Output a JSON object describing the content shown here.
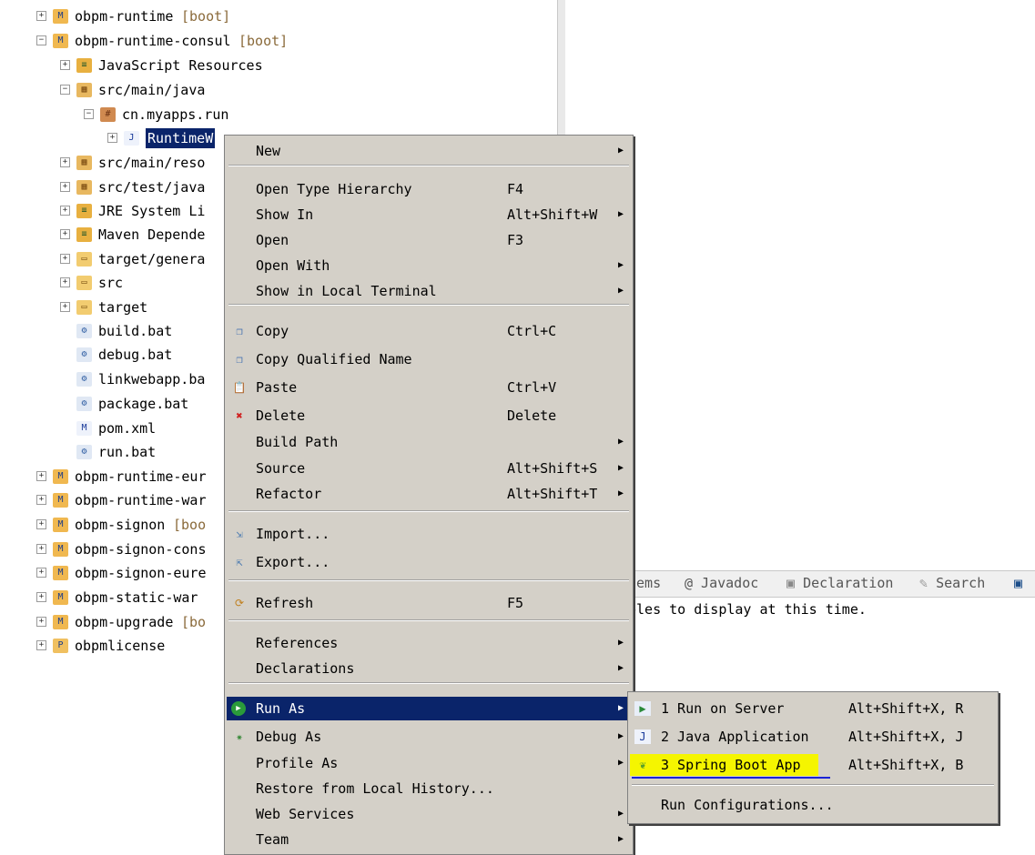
{
  "tree": {
    "items": [
      {
        "label": "obpm-runtime",
        "suffix": "[boot]",
        "expander": "+",
        "icon": "maven-project-icon"
      },
      {
        "label": "obpm-runtime-consul",
        "suffix": "[boot]",
        "expander": "−",
        "icon": "maven-project-icon"
      },
      {
        "label": "JavaScript Resources",
        "expander": "+",
        "icon": "library-icon"
      },
      {
        "label": "src/main/java",
        "expander": "−",
        "icon": "source-folder-icon"
      },
      {
        "label": "cn.myapps.run",
        "expander": "−",
        "icon": "package-icon"
      },
      {
        "label": "RuntimeW",
        "expander": "+",
        "icon": "java-file-icon",
        "selected": true
      },
      {
        "label": "src/main/reso",
        "expander": "+",
        "icon": "source-folder-icon"
      },
      {
        "label": "src/test/java",
        "expander": "+",
        "icon": "source-folder-icon"
      },
      {
        "label": "JRE System Li",
        "expander": "+",
        "icon": "library-icon"
      },
      {
        "label": "Maven Depende",
        "expander": "+",
        "icon": "library-icon"
      },
      {
        "label": "target/genera",
        "expander": "+",
        "icon": "folder-icon"
      },
      {
        "label": "src",
        "expander": "+",
        "icon": "folder-icon"
      },
      {
        "label": "target",
        "expander": "+",
        "icon": "folder-icon"
      },
      {
        "label": "build.bat",
        "expander": "",
        "icon": "bat-file-icon"
      },
      {
        "label": "debug.bat",
        "expander": "",
        "icon": "bat-file-icon"
      },
      {
        "label": "linkwebapp.ba",
        "expander": "",
        "icon": "bat-file-icon"
      },
      {
        "label": "package.bat",
        "expander": "",
        "icon": "bat-file-icon"
      },
      {
        "label": "pom.xml",
        "expander": "",
        "icon": "pom-file-icon"
      },
      {
        "label": "run.bat",
        "expander": "",
        "icon": "bat-file-icon"
      },
      {
        "label": "obpm-runtime-eur",
        "expander": "+",
        "icon": "maven-project-icon"
      },
      {
        "label": "obpm-runtime-war",
        "expander": "+",
        "icon": "maven-project-icon"
      },
      {
        "label": "obpm-signon",
        "suffix": "[boo",
        "expander": "+",
        "icon": "maven-project-icon"
      },
      {
        "label": "obpm-signon-cons",
        "expander": "+",
        "icon": "maven-project-icon"
      },
      {
        "label": "obpm-signon-eure",
        "expander": "+",
        "icon": "maven-project-icon"
      },
      {
        "label": "obpm-static-war",
        "expander": "+",
        "icon": "maven-project-icon"
      },
      {
        "label": "obpm-upgrade",
        "suffix": "[bo",
        "expander": "+",
        "icon": "maven-project-icon"
      },
      {
        "label": "obpmlicense",
        "expander": "+",
        "icon": "project-icon"
      }
    ]
  },
  "context_menu": {
    "items": [
      {
        "label": "New",
        "shortcut": "",
        "submenu": true,
        "icon": ""
      },
      {
        "label": "Open Type Hierarchy",
        "shortcut": "F4",
        "submenu": false,
        "icon": ""
      },
      {
        "label": "Show In",
        "shortcut": "Alt+Shift+W",
        "submenu": true,
        "icon": ""
      },
      {
        "label": "Open",
        "shortcut": "F3",
        "submenu": false,
        "icon": ""
      },
      {
        "label": "Open With",
        "shortcut": "",
        "submenu": true,
        "icon": ""
      },
      {
        "label": "Show in Local Terminal",
        "shortcut": "",
        "submenu": true,
        "icon": ""
      },
      {
        "label": "Copy",
        "shortcut": "Ctrl+C",
        "submenu": false,
        "icon": "copy-icon"
      },
      {
        "label": "Copy Qualified Name",
        "shortcut": "",
        "submenu": false,
        "icon": "copy-qualified-name-icon"
      },
      {
        "label": "Paste",
        "shortcut": "Ctrl+V",
        "submenu": false,
        "icon": "paste-icon"
      },
      {
        "label": "Delete",
        "shortcut": "Delete",
        "submenu": false,
        "icon": "delete-icon"
      },
      {
        "label": "Build Path",
        "shortcut": "",
        "submenu": true,
        "icon": ""
      },
      {
        "label": "Source",
        "shortcut": "Alt+Shift+S",
        "submenu": true,
        "icon": ""
      },
      {
        "label": "Refactor",
        "shortcut": "Alt+Shift+T",
        "submenu": true,
        "icon": ""
      },
      {
        "label": "Import...",
        "shortcut": "",
        "submenu": false,
        "icon": "import-icon"
      },
      {
        "label": "Export...",
        "shortcut": "",
        "submenu": false,
        "icon": "export-icon"
      },
      {
        "label": "Refresh",
        "shortcut": "F5",
        "submenu": false,
        "icon": "refresh-icon"
      },
      {
        "label": "References",
        "shortcut": "",
        "submenu": true,
        "icon": ""
      },
      {
        "label": "Declarations",
        "shortcut": "",
        "submenu": true,
        "icon": ""
      },
      {
        "label": "Run As",
        "shortcut": "",
        "submenu": true,
        "icon": "run-icon",
        "highlighted": true
      },
      {
        "label": "Debug As",
        "shortcut": "",
        "submenu": true,
        "icon": "debug-icon"
      },
      {
        "label": "Profile As",
        "shortcut": "",
        "submenu": true,
        "icon": ""
      },
      {
        "label": "Restore from Local History...",
        "shortcut": "",
        "submenu": false,
        "icon": ""
      },
      {
        "label": "Web Services",
        "shortcut": "",
        "submenu": true,
        "icon": ""
      },
      {
        "label": "Team",
        "shortcut": "",
        "submenu": true,
        "icon": ""
      }
    ]
  },
  "run_as_submenu": {
    "items": [
      {
        "label": "1 Run on Server",
        "shortcut": "Alt+Shift+X, R",
        "icon": "run-on-server-icon"
      },
      {
        "label": "2 Java Application",
        "shortcut": "Alt+Shift+X, J",
        "icon": "java-application-icon"
      },
      {
        "label": "3 Spring Boot App",
        "shortcut": "Alt+Shift+X, B",
        "icon": "spring-boot-icon",
        "highlighted": true
      },
      {
        "label": "Run Configurations...",
        "shortcut": "",
        "icon": ""
      }
    ]
  },
  "bottom_panel": {
    "tabs": [
      "lems",
      "@ Javadoc",
      "Declaration",
      "Search"
    ],
    "message": "bles to display at this time."
  },
  "colors": {
    "selection": "#0a246a",
    "menu_bg": "#d4d0c8",
    "spring_highlight": "#f5f500",
    "underline": "#1a22d6"
  }
}
